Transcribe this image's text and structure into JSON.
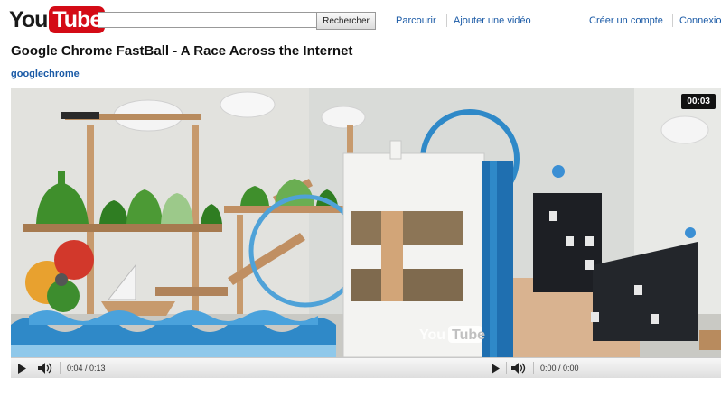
{
  "header": {
    "logo_you": "You",
    "logo_tube": "Tube",
    "search_placeholder": "",
    "search_button": "Rechercher",
    "nav": {
      "parcourir": "Parcourir",
      "upload": "Ajouter une vidéo",
      "create_account": "Créer un compte",
      "login": "Connexion"
    }
  },
  "video": {
    "title": "Google Chrome FastBall - A Race Across the Internet",
    "channel": "googlechrome",
    "timer": "00:03",
    "watermark_you": "You",
    "watermark_tube": "Tube"
  },
  "player_left": {
    "time": "0:04 / 0:13",
    "progress": 0.31
  },
  "player_right": {
    "time": "0:00 / 0:00",
    "progress": 0
  },
  "icons": {
    "play": "play-icon",
    "volume": "volume-icon"
  },
  "colors": {
    "brand_red": "#d40b16",
    "link_blue": "#1a5aa6"
  }
}
